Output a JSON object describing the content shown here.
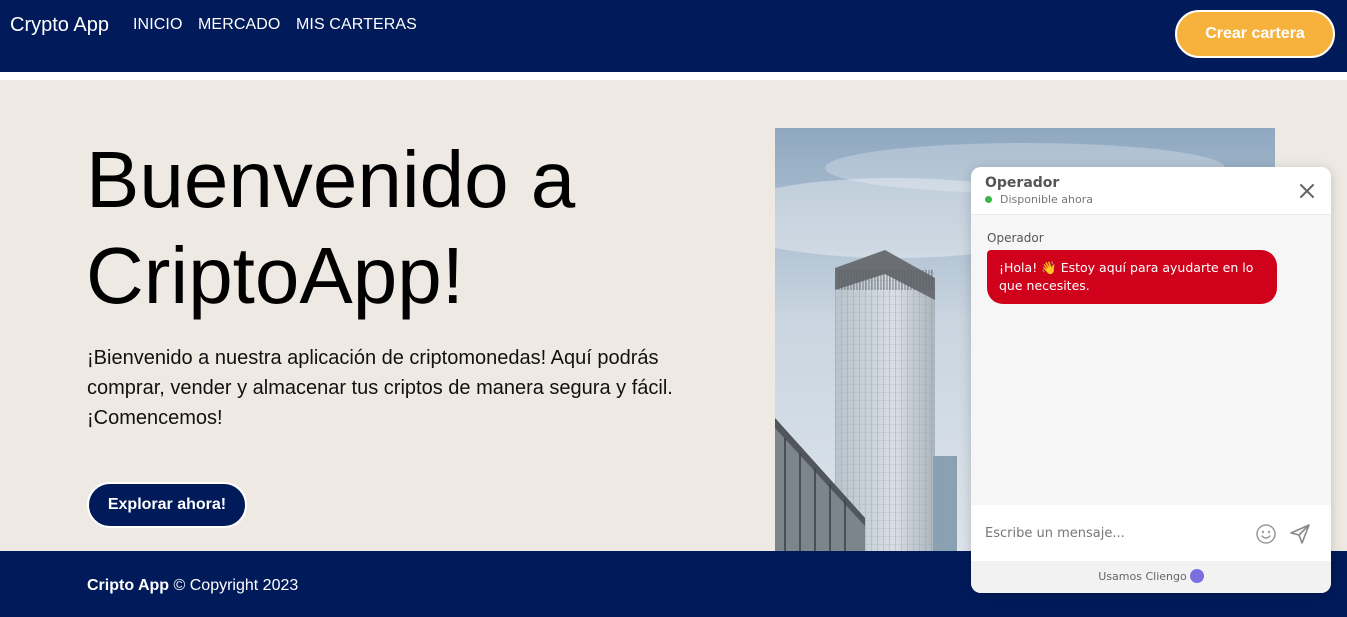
{
  "header": {
    "brand": "Crypto App",
    "nav": [
      "INICIO",
      "MERCADO",
      "MIS CARTERAS"
    ],
    "create_button": "Crear cartera"
  },
  "hero": {
    "title": "Buenvenido a CriptoApp!",
    "text": "¡Bienvenido a nuestra aplicación de criptomonedas! Aquí podrás comprar, vender y almacenar tus criptos de manera segura y fácil. ¡Comencemos!",
    "explore_button": "Explorar ahora!"
  },
  "footer": {
    "brand": "Cripto App",
    "copyright": " © Copyright 2023"
  },
  "chat": {
    "operator_name": "Operador",
    "status": "Disponible ahora",
    "sender_label": "Operador",
    "message": "¡Hola! 👋 Estoy aquí para ayudarte en lo que necesites.",
    "input_placeholder": "Escribe un mensaje...",
    "powered_by": "Usamos Cliengo"
  },
  "colors": {
    "navy": "#001a5a",
    "accent_orange": "#f6b23d",
    "hero_bg": "#eee9e3",
    "chat_bubble": "#d0021b",
    "status_online": "#3bb54a"
  }
}
